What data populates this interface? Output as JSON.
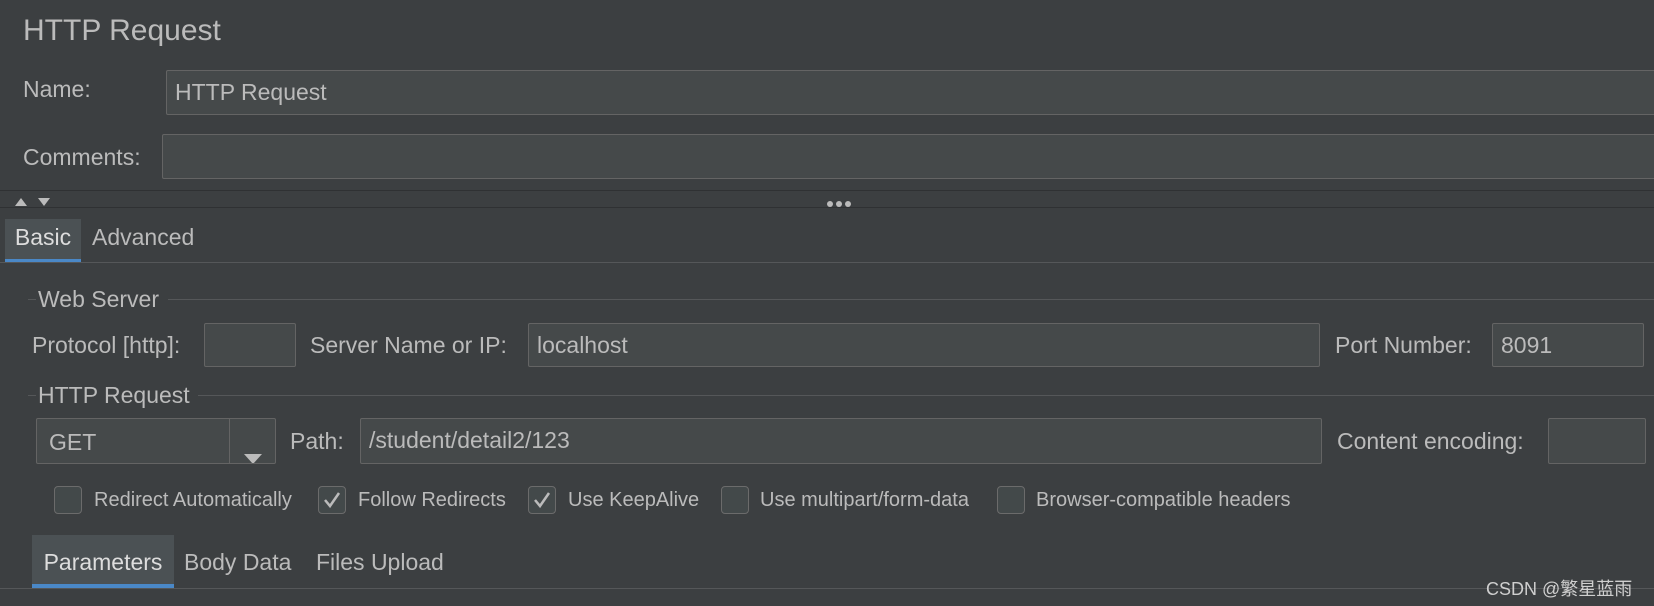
{
  "panel": {
    "title": "HTTP Request",
    "name_label": "Name:",
    "name_value": "HTTP Request",
    "comments_label": "Comments:",
    "comments_value": ""
  },
  "tabs": [
    {
      "label": "Basic",
      "selected": true
    },
    {
      "label": "Advanced",
      "selected": false
    }
  ],
  "web_server": {
    "legend": "Web Server",
    "protocol_label": "Protocol [http]:",
    "protocol_value": "",
    "server_label": "Server Name or IP:",
    "server_value": "localhost",
    "port_label": "Port Number:",
    "port_value": "8091"
  },
  "http_request": {
    "legend": "HTTP Request",
    "method": "GET",
    "path_label": "Path:",
    "path_value": "/student/detail2/123",
    "encoding_label": "Content encoding:",
    "encoding_value": ""
  },
  "options": [
    {
      "label": "Redirect Automatically",
      "checked": false
    },
    {
      "label": "Follow Redirects",
      "checked": true
    },
    {
      "label": "Use KeepAlive",
      "checked": true
    },
    {
      "label": "Use multipart/form-data",
      "checked": false
    },
    {
      "label": "Browser-compatible headers",
      "checked": false
    }
  ],
  "sub_tabs": [
    {
      "label": "Parameters",
      "selected": true
    },
    {
      "label": "Body Data",
      "selected": false
    },
    {
      "label": "Files Upload",
      "selected": false
    }
  ],
  "watermark": "CSDN @繁星蓝雨",
  "colors": {
    "accent": "#4a88c7",
    "background": "#3c3f41",
    "field": "#45494a"
  },
  "icons": [
    "collapse-up-icon",
    "expand-down-icon",
    "drag-handle-icon",
    "dropdown-arrow-icon",
    "checkmark-icon"
  ]
}
